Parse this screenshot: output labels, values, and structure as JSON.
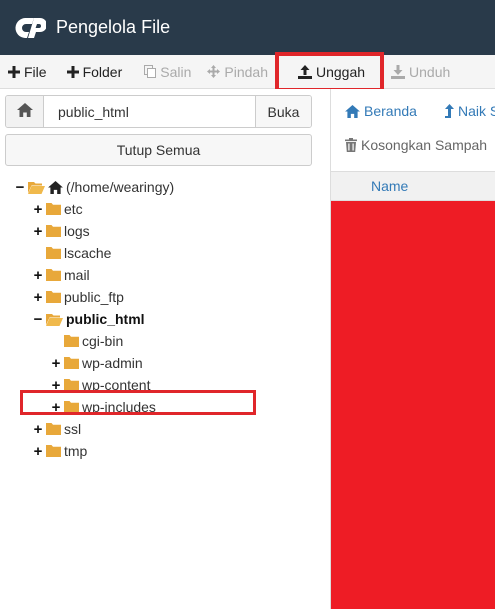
{
  "header": {
    "title": "Pengelola File"
  },
  "toolbar": {
    "file": "File",
    "folder": "Folder",
    "copy": "Salin",
    "move": "Pindah",
    "upload": "Unggah",
    "download": "Unduh"
  },
  "left": {
    "path_value": "public_html",
    "go_label": "Buka",
    "collapse_label": "Tutup Semua"
  },
  "tree": {
    "root": "(/home/wearingy)",
    "items": [
      "etc",
      "logs",
      "lscache",
      "mail",
      "public_ftp",
      "public_html",
      "ssl",
      "tmp"
    ],
    "children": [
      "cgi-bin",
      "wp-admin",
      "wp-content",
      "wp-includes"
    ]
  },
  "right": {
    "home": "Beranda",
    "up": "Naik S",
    "empty_trash": "Kosongkan Sampah",
    "col_name": "Name"
  },
  "colors": {
    "header_bg": "#293a4a",
    "highlight": "#e0262a",
    "folder": "#e8a83a",
    "link": "#337ab7",
    "red_area": "#ee1c25"
  }
}
